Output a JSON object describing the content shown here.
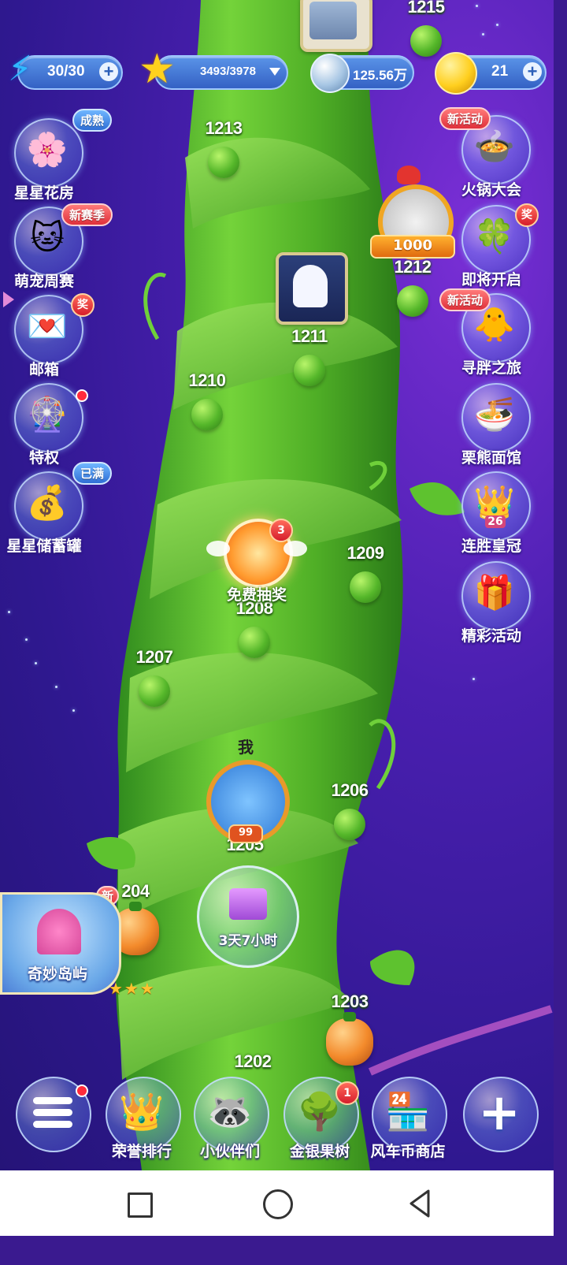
{
  "hud": {
    "energy": "30/30",
    "stars": "3493/3978",
    "coins": "125.56万",
    "gold": "21"
  },
  "left_menu": [
    {
      "label": "星星花房",
      "badge": "成熟",
      "icon": "flower-house-icon"
    },
    {
      "label": "萌宠周赛",
      "badge": "新赛季",
      "icon": "pet-icon"
    },
    {
      "label": "邮箱",
      "badge": "奖",
      "icon": "mail-icon"
    },
    {
      "label": "特权",
      "icon": "privilege-icon"
    },
    {
      "label": "星星储蓄罐",
      "badge": "已满",
      "icon": "piggy-bank-icon"
    }
  ],
  "right_menu": [
    {
      "label": "火锅大会",
      "badge": "新活动",
      "icon": "hotpot-icon"
    },
    {
      "label": "即将开启",
      "badge": "奖",
      "icon": "clover-icon"
    },
    {
      "label": "寻胖之旅",
      "badge": "新活动",
      "icon": "chick-icon"
    },
    {
      "label": "栗熊面馆",
      "icon": "noodle-icon"
    },
    {
      "label": "连胜皇冠",
      "badge": "26",
      "icon": "crown-icon"
    },
    {
      "label": "精彩活动",
      "icon": "gift-icon"
    }
  ],
  "levels": [
    "1215",
    "1213",
    "1212",
    "1211",
    "1210",
    "1209",
    "1208",
    "1207",
    "1206",
    "1205",
    "204",
    "1203",
    "1202"
  ],
  "new_badge": "新",
  "friend_score": "1000",
  "lottery": {
    "label": "免费抽奖",
    "count": "3"
  },
  "player": {
    "tag": "我",
    "level": "99"
  },
  "gift_timer": "3天7小时",
  "island_label": "奇妙岛屿",
  "bottom_menu": [
    {
      "label": "",
      "icon": "menu-list-icon"
    },
    {
      "label": "荣誉排行",
      "icon": "ranking-crown-icon"
    },
    {
      "label": "小伙伴们",
      "icon": "friends-icon"
    },
    {
      "label": "金银果树",
      "badge": "1",
      "icon": "fruit-tree-icon"
    },
    {
      "label": "风车币商店",
      "icon": "shop-icon"
    },
    {
      "label": "",
      "icon": "plus-icon"
    }
  ],
  "colors": {
    "background": "#3a1fa8",
    "stalk": "#5cbf2e",
    "pill": "#3d6fd0"
  }
}
